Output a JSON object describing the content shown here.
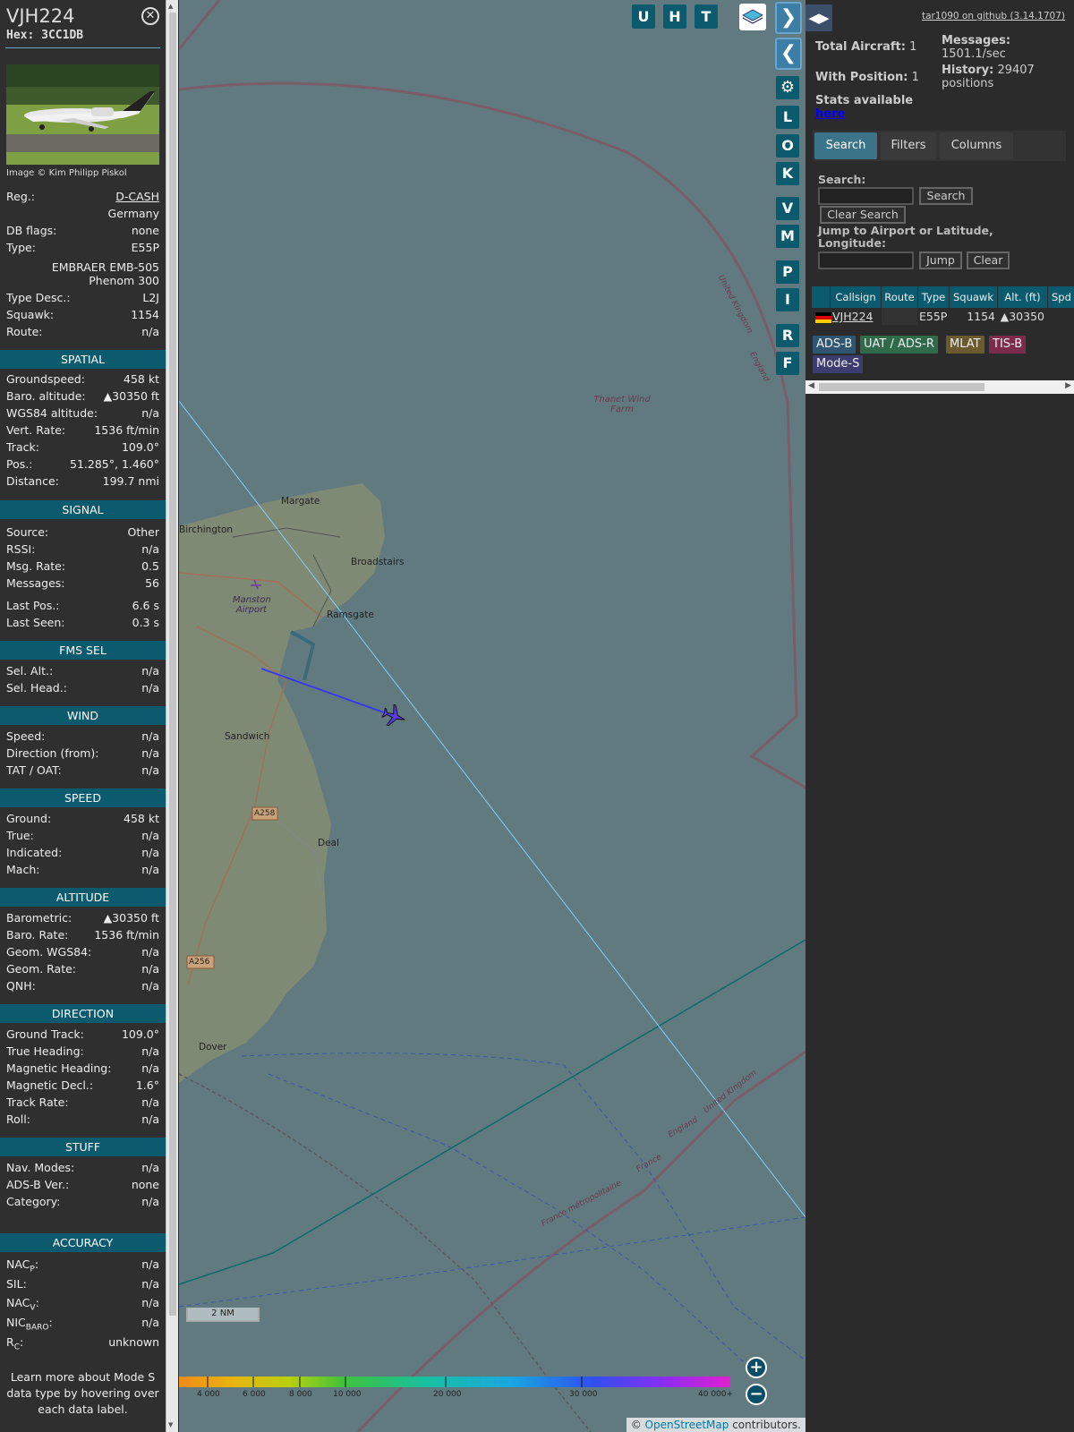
{
  "sidebar": {
    "callsign": "VJH224",
    "hex": "Hex: 3CC1DB",
    "close_icon": "close-circle-icon",
    "photo_credit": "Image © Kim Philipp Piskol",
    "top_rows": [
      {
        "label": "Reg.:",
        "value": "D-CASH",
        "link": true
      },
      {
        "label": "",
        "value": "Germany"
      },
      {
        "label": "DB flags:",
        "value": "none"
      },
      {
        "label": "Type:",
        "value": "E55P"
      }
    ],
    "type_long_1": "EMBRAER EMB-505",
    "type_long_2": "Phenom 300",
    "mid_rows": [
      {
        "label": "Type Desc.:",
        "value": "L2J"
      },
      {
        "label": "Squawk:",
        "value": "1154"
      },
      {
        "label": "Route:",
        "value": "n/a"
      }
    ],
    "sections": {
      "spatial": "SPATIAL",
      "signal": "SIGNAL",
      "fms": "FMS SEL",
      "wind": "WIND",
      "speed": "SPEED",
      "altitude": "ALTITUDE",
      "direction": "DIRECTION",
      "stuff": "STUFF",
      "accuracy": "ACCURACY"
    },
    "spatial": [
      {
        "label": "Groundspeed:",
        "value": "458 kt"
      },
      {
        "label": "Baro. altitude:",
        "value": "▲30350 ft"
      },
      {
        "label": "WGS84 altitude:",
        "value": "n/a"
      },
      {
        "label": "Vert. Rate:",
        "value": "1536 ft/min"
      },
      {
        "label": "Track:",
        "value": "109.0°"
      },
      {
        "label": "Pos.:",
        "value": "51.285°, 1.460°"
      },
      {
        "label": "Distance:",
        "value": "199.7 nmi"
      }
    ],
    "signal": [
      {
        "label": "Source:",
        "value": "Other"
      },
      {
        "label": "RSSI:",
        "value": "n/a"
      },
      {
        "label": "Msg. Rate:",
        "value": "0.5"
      },
      {
        "label": "Messages:",
        "value": "56"
      },
      {
        "label": "Last Pos.:",
        "value": "6.6 s"
      },
      {
        "label": "Last Seen:",
        "value": "0.3 s"
      }
    ],
    "fms": [
      {
        "label": "Sel. Alt.:",
        "value": "n/a"
      },
      {
        "label": "Sel. Head.:",
        "value": "n/a"
      }
    ],
    "wind": [
      {
        "label": "Speed:",
        "value": "n/a"
      },
      {
        "label": "Direction (from):",
        "value": "n/a"
      },
      {
        "label": "TAT / OAT:",
        "value": "n/a"
      }
    ],
    "speed": [
      {
        "label": "Ground:",
        "value": "458 kt"
      },
      {
        "label": "True:",
        "value": "n/a"
      },
      {
        "label": "Indicated:",
        "value": "n/a"
      },
      {
        "label": "Mach:",
        "value": "n/a"
      }
    ],
    "altitude": [
      {
        "label": "Barometric:",
        "value": "▲30350 ft"
      },
      {
        "label": "Baro. Rate:",
        "value": "1536 ft/min"
      },
      {
        "label": "Geom. WGS84:",
        "value": "n/a"
      },
      {
        "label": "Geom. Rate:",
        "value": "n/a"
      },
      {
        "label": "QNH:",
        "value": "n/a"
      }
    ],
    "direction": [
      {
        "label": "Ground Track:",
        "value": "109.0°"
      },
      {
        "label": "True Heading:",
        "value": "n/a"
      },
      {
        "label": "Magnetic Heading:",
        "value": "n/a"
      },
      {
        "label": "Magnetic Decl.:",
        "value": "1.6°"
      },
      {
        "label": "Track Rate:",
        "value": "n/a"
      },
      {
        "label": "Roll:",
        "value": "n/a"
      }
    ],
    "stuff": [
      {
        "label": "Nav. Modes:",
        "value": "n/a"
      },
      {
        "label": "ADS-B Ver.:",
        "value": "none"
      },
      {
        "label": "Category:",
        "value": "n/a"
      }
    ],
    "accuracy": [
      {
        "label": "NAC",
        "sub": "P",
        "suffix": ":",
        "value": "n/a"
      },
      {
        "label": "SIL:",
        "sub": "",
        "suffix": "",
        "value": "n/a"
      },
      {
        "label": "NAC",
        "sub": "V",
        "suffix": ":",
        "value": "n/a"
      },
      {
        "label": "NIC",
        "sub": "BARO",
        "suffix": ":",
        "value": "n/a"
      },
      {
        "label": "R",
        "sub": "C",
        "suffix": ":",
        "value": "unknown"
      }
    ],
    "learn_more": "Learn more about Mode S data type by hovering over each data label."
  },
  "map": {
    "top_buttons": [
      "U",
      "H",
      "T"
    ],
    "side_buttons": [
      "L",
      "O",
      "K",
      "V",
      "M",
      "P",
      "I",
      "R",
      "F"
    ],
    "labels": {
      "margate": "Margate",
      "birchington": "Birchington",
      "broadstairs": "Broadstairs",
      "manston": "Manston Airport",
      "ramsgate": "Ramsgate",
      "sandwich": "Sandwich",
      "deal": "Deal",
      "a258": "A258",
      "a256": "A256",
      "dover": "Dover",
      "thanet": "Thanet Wind Farm",
      "uk1": "United Kingdom",
      "eng1": "England",
      "uk2": "United Kingdom",
      "eng2": "England",
      "france": "France",
      "france_metro": "France métropolitaine"
    },
    "scale": "2 NM",
    "color_ticks": [
      "4 000",
      "6 000",
      "8 000",
      "10 000",
      "20 000",
      "30 000",
      "40 000+"
    ],
    "attribution_prefix": "© ",
    "attribution_link": "OpenStreetMap",
    "attribution_suffix": " contributors."
  },
  "panel": {
    "github": "tar1090 on github (3.14.1707)",
    "total_label": "Total Aircraft:",
    "total_value": "1",
    "with_pos_label": "With Position:",
    "with_pos_value": "1",
    "stats_label": "Stats available",
    "stats_link": "here",
    "messages_label": "Messages:",
    "messages_value": "1501.1/sec",
    "history_label": "History:",
    "history_value": "29407",
    "history_unit": "positions",
    "tabs": [
      "Search",
      "Filters",
      "Columns"
    ],
    "search_label": "Search:",
    "search_button": "Search",
    "clear_search_button": "Clear Search",
    "jump_label": "Jump to Airport or Latitude, Longitude:",
    "jump_button": "Jump",
    "clear_button": "Clear",
    "columns": [
      "Callsign",
      "Route",
      "Type",
      "Squawk",
      "Alt. (ft)",
      "Spd"
    ],
    "rows": [
      {
        "callsign": "VJH224",
        "route": "",
        "type": "E55P",
        "squawk": "1154",
        "alt": "▲30350"
      }
    ],
    "badges": [
      {
        "text": "ADS-B",
        "color": "#2e5670"
      },
      {
        "text": "UAT / ADS-R",
        "color": "#2f6b4a"
      },
      {
        "text": "MLAT",
        "color": "#6b5a2e"
      },
      {
        "text": "TIS-B",
        "color": "#7a2c4a"
      },
      {
        "text": "Mode-S",
        "color": "#3c3c6e"
      }
    ]
  }
}
